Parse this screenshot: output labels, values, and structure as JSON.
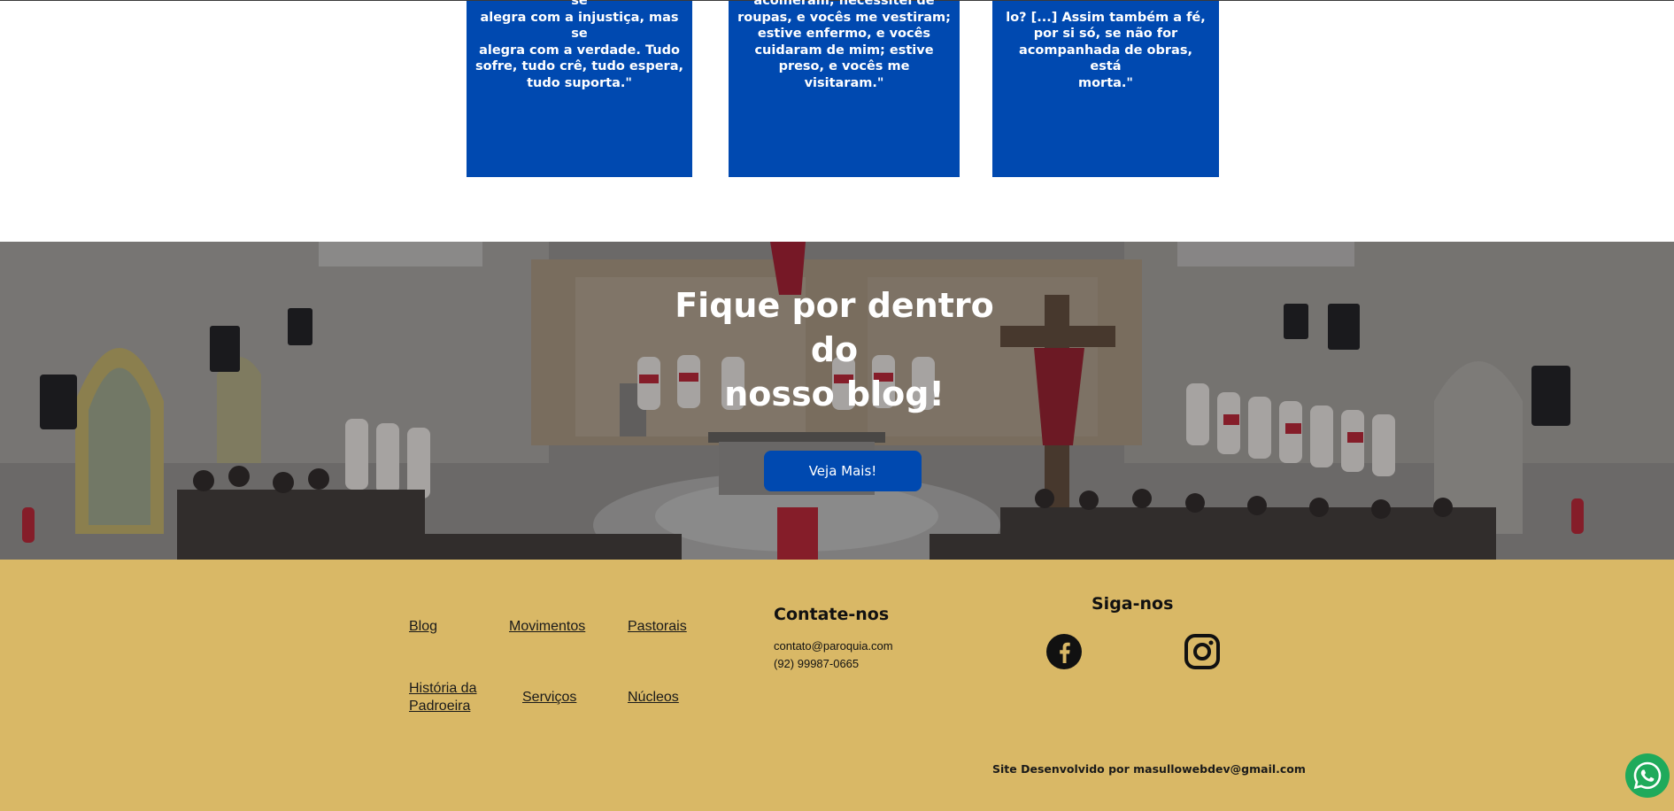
{
  "quotes": [
    {
      "text": "não se ira facilmente, não\nguarda rancor. O amor não se\nalegra com a injustiça, mas se\nalegra com a verdade. Tudo\nsofre, tudo crê, tudo espera,\ntudo suporta.\""
    },
    {
      "text": "acolheram; necessitei de\nroupas, e vocês me vestiram;\nestive enfermo, e vocês\ncuidaram de mim; estive\npreso, e vocês me visitaram.\""
    },
    {
      "text": "lo? [...] Assim também a fé,\npor si só, se não for\nacompanhada de obras, está\nmorta.\""
    }
  ],
  "banner": {
    "title": "Fique por dentro do\nnosso blog!",
    "button_label": "Veja Mais!"
  },
  "footer": {
    "links": {
      "blog": "Blog",
      "movimentos": "Movimentos",
      "pastorais": "Pastorais",
      "historia": "História da\nPadroeira",
      "servicos": "Serviços",
      "nucleos": "Núcleos"
    },
    "contact": {
      "heading": "Contate-nos",
      "email": "contato@paroquia.com",
      "phone": "(92) 99987-0665"
    },
    "follow": {
      "heading": "Siga-nos",
      "icons": [
        "facebook-icon",
        "instagram-icon"
      ]
    },
    "credit": "Site Desenvolvido por masullowebdev@gmail.com"
  },
  "floating": {
    "icon": "whatsapp-icon"
  },
  "colors": {
    "primary_blue": "#0049b0",
    "footer_gold": "#d9b866",
    "whatsapp_green": "#1faa5b"
  }
}
